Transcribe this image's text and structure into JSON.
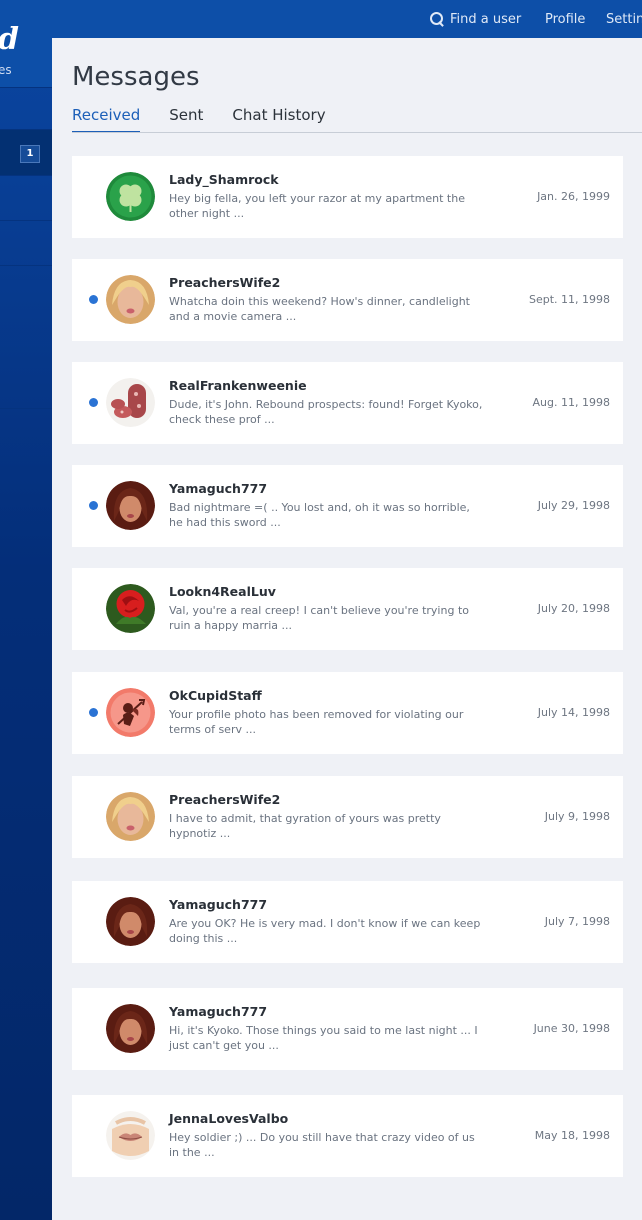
{
  "header": {
    "logo_text": "d",
    "nav": [
      {
        "label": "Find a user",
        "icon": "search-icon"
      },
      {
        "label": "Profile"
      },
      {
        "label": "Settin"
      }
    ]
  },
  "sidebar": {
    "items": [
      {
        "label": "es"
      },
      {
        "badge": "1"
      }
    ]
  },
  "page": {
    "title": "Messages",
    "tabs": [
      {
        "label": "Received",
        "active": true
      },
      {
        "label": "Sent",
        "active": false
      },
      {
        "label": "Chat History",
        "active": false
      }
    ]
  },
  "messages": [
    {
      "name": "Lady_Shamrock",
      "preview": "Hey big fella, you left your razor at my apartment the other night ...",
      "date": "Jan. 26, 1999",
      "unread": false,
      "avatar": "shamrock-avatar"
    },
    {
      "name": "PreachersWife2",
      "preview": "Whatcha doin this weekend? How's dinner, candlelight and a movie camera ...",
      "date": "Sept. 11, 1998",
      "unread": true,
      "avatar": "blonde-woman-avatar"
    },
    {
      "name": "RealFrankenweenie",
      "preview": "Dude, it's John. Rebound prospects: found! Forget Kyoko, check these prof ...",
      "date": "Aug. 11, 1998",
      "unread": true,
      "avatar": "sausage-avatar"
    },
    {
      "name": "Yamaguch777",
      "preview": "Bad nightmare =( .. You lost and, oh it was so horrible, he had this sword ...",
      "date": "July 29, 1998",
      "unread": true,
      "avatar": "brunette-woman-avatar"
    },
    {
      "name": "Lookn4RealLuv",
      "preview": "Val, you're a real creep! I can't believe you're trying to ruin a happy marria ...",
      "date": "July 20, 1998",
      "unread": false,
      "avatar": "rose-avatar"
    },
    {
      "name": "OkCupidStaff",
      "preview": "Your profile photo has been removed for violating our terms of serv ...",
      "date": "July 14, 1998",
      "unread": true,
      "avatar": "cupid-avatar"
    },
    {
      "name": "PreachersWife2",
      "preview": "I have to admit, that gyration of yours was pretty hypnotiz ...",
      "date": "July 9, 1998",
      "unread": false,
      "avatar": "blonde-woman-avatar"
    },
    {
      "name": "Yamaguch777",
      "preview": "Are you OK? He is very mad. I don't know if we can keep doing this ...",
      "date": "July 7, 1998",
      "unread": false,
      "avatar": "brunette-woman-avatar"
    },
    {
      "name": "Yamaguch777",
      "preview": "Hi, it's Kyoko. Those things you said to me last night ... I just can't get you ...",
      "date": "June 30, 1998",
      "unread": false,
      "avatar": "brunette-woman-avatar"
    },
    {
      "name": "JennaLovesValbo",
      "preview": "Hey soldier ;) ... Do you still have that crazy video of us in the ...",
      "date": "May 18, 1998",
      "unread": false,
      "avatar": "lips-avatar"
    }
  ],
  "colors": {
    "brand": "#0d4fa8",
    "accent": "#1c5fb8",
    "unread_dot": "#2a73d4"
  }
}
